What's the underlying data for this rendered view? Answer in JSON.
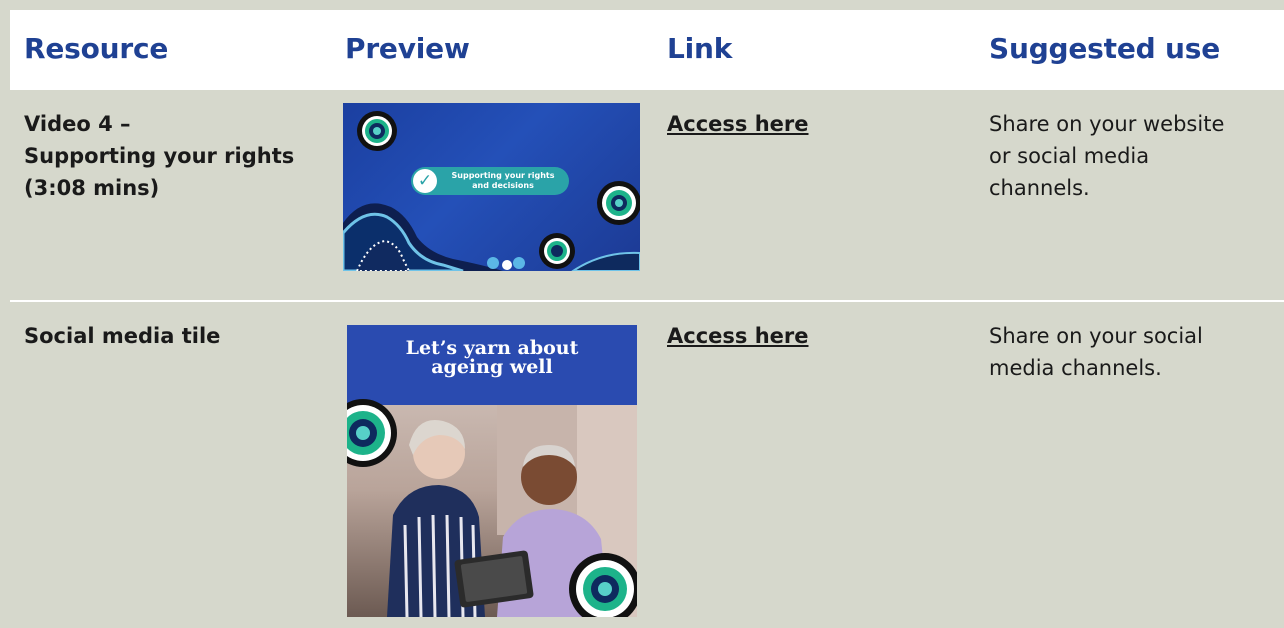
{
  "headers": {
    "resource": "Resource",
    "preview": "Preview",
    "link": "Link",
    "suggested_use": "Suggested use"
  },
  "rows": [
    {
      "resource_lines": [
        "Video 4 –",
        "Supporting your rights",
        "(3:08 mins)"
      ],
      "preview": {
        "type": "video-thumbnail",
        "caption_lines": [
          "Supporting your rights",
          "and decisions"
        ],
        "check_icon": "check-circle-icon"
      },
      "link": "Access here",
      "suggested_use_lines": [
        "Share on your website",
        "or social media",
        "channels."
      ]
    },
    {
      "resource_lines": [
        "Social media tile"
      ],
      "preview": {
        "type": "social-tile",
        "title_lines": [
          "Let’s yarn about",
          "ageing well"
        ]
      },
      "link": "Access here",
      "suggested_use_lines": [
        "Share on your social",
        "media channels."
      ]
    }
  ],
  "colors": {
    "header_text": "#1f4193",
    "header_bg": "#ffffff",
    "row_bg": "#d6d8cc",
    "grid_lines": "#ffffff",
    "body_text": "#1a1a1a",
    "video_bg": "#1b3fa0",
    "pill_teal": "#2aa3a8"
  }
}
